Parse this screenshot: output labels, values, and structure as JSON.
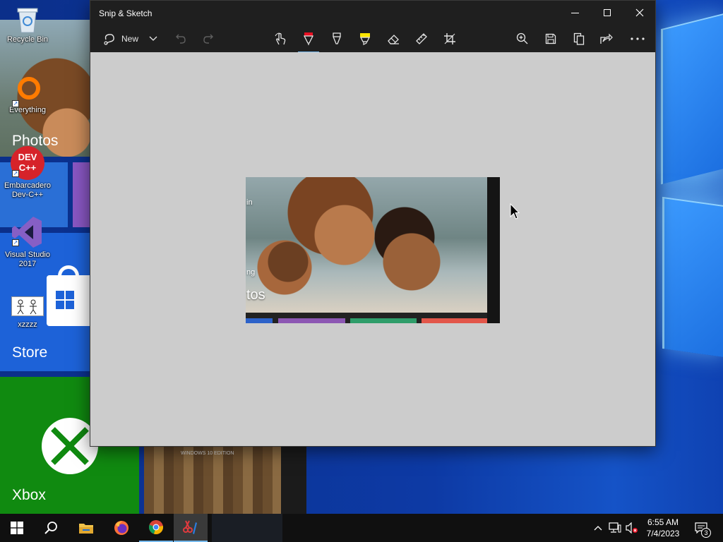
{
  "desktop": {
    "icons": [
      {
        "label": "Recycle Bin",
        "icon": "recycle-bin-icon"
      },
      {
        "label": "Everything",
        "icon": "everything-search-icon"
      },
      {
        "label": "Embarcadero Dev-C++",
        "icon": "devcpp-icon",
        "badge": "DEV C++"
      },
      {
        "label": "Visual Studio 2017",
        "icon": "visual-studio-icon"
      },
      {
        "label": "xzzzz",
        "icon": "image-file-icon"
      }
    ]
  },
  "start_tiles": {
    "photos": "Photos",
    "store": "Store",
    "xbox": "Xbox",
    "minecraft": "WINDOWS 10 EDITION"
  },
  "window": {
    "title": "Snip & Sketch",
    "controls": {
      "minimize": "minimize-icon",
      "maximize": "maximize-icon",
      "close": "close-icon"
    },
    "toolbar": {
      "new_label": "New",
      "tools": [
        "touch-writing-icon",
        "ballpoint-pen-icon",
        "pencil-icon",
        "highlighter-icon",
        "eraser-icon",
        "ruler-icon",
        "crop-icon"
      ],
      "actions": [
        "zoom-icon",
        "save-icon",
        "copy-icon",
        "share-icon",
        "more-icon"
      ],
      "active_pen_color": "#e81123",
      "highlighter_color": "#ffe600"
    },
    "capture": {
      "snippet_left_text": "in",
      "snippet_mid_text": "ng",
      "snippet_tile_label": "tos",
      "strip_colors": [
        "#2d62c9",
        "#8c57b3",
        "#2f9d6a",
        "#e2564a"
      ]
    }
  },
  "taskbar": {
    "apps": [
      "file-explorer-icon",
      "firefox-icon",
      "chrome-icon",
      "snip-sketch-icon"
    ],
    "clock_time": "6:55 AM",
    "clock_date": "7/4/2023",
    "notification_count": "3",
    "colors": {
      "accent": "#76b9ed"
    }
  }
}
